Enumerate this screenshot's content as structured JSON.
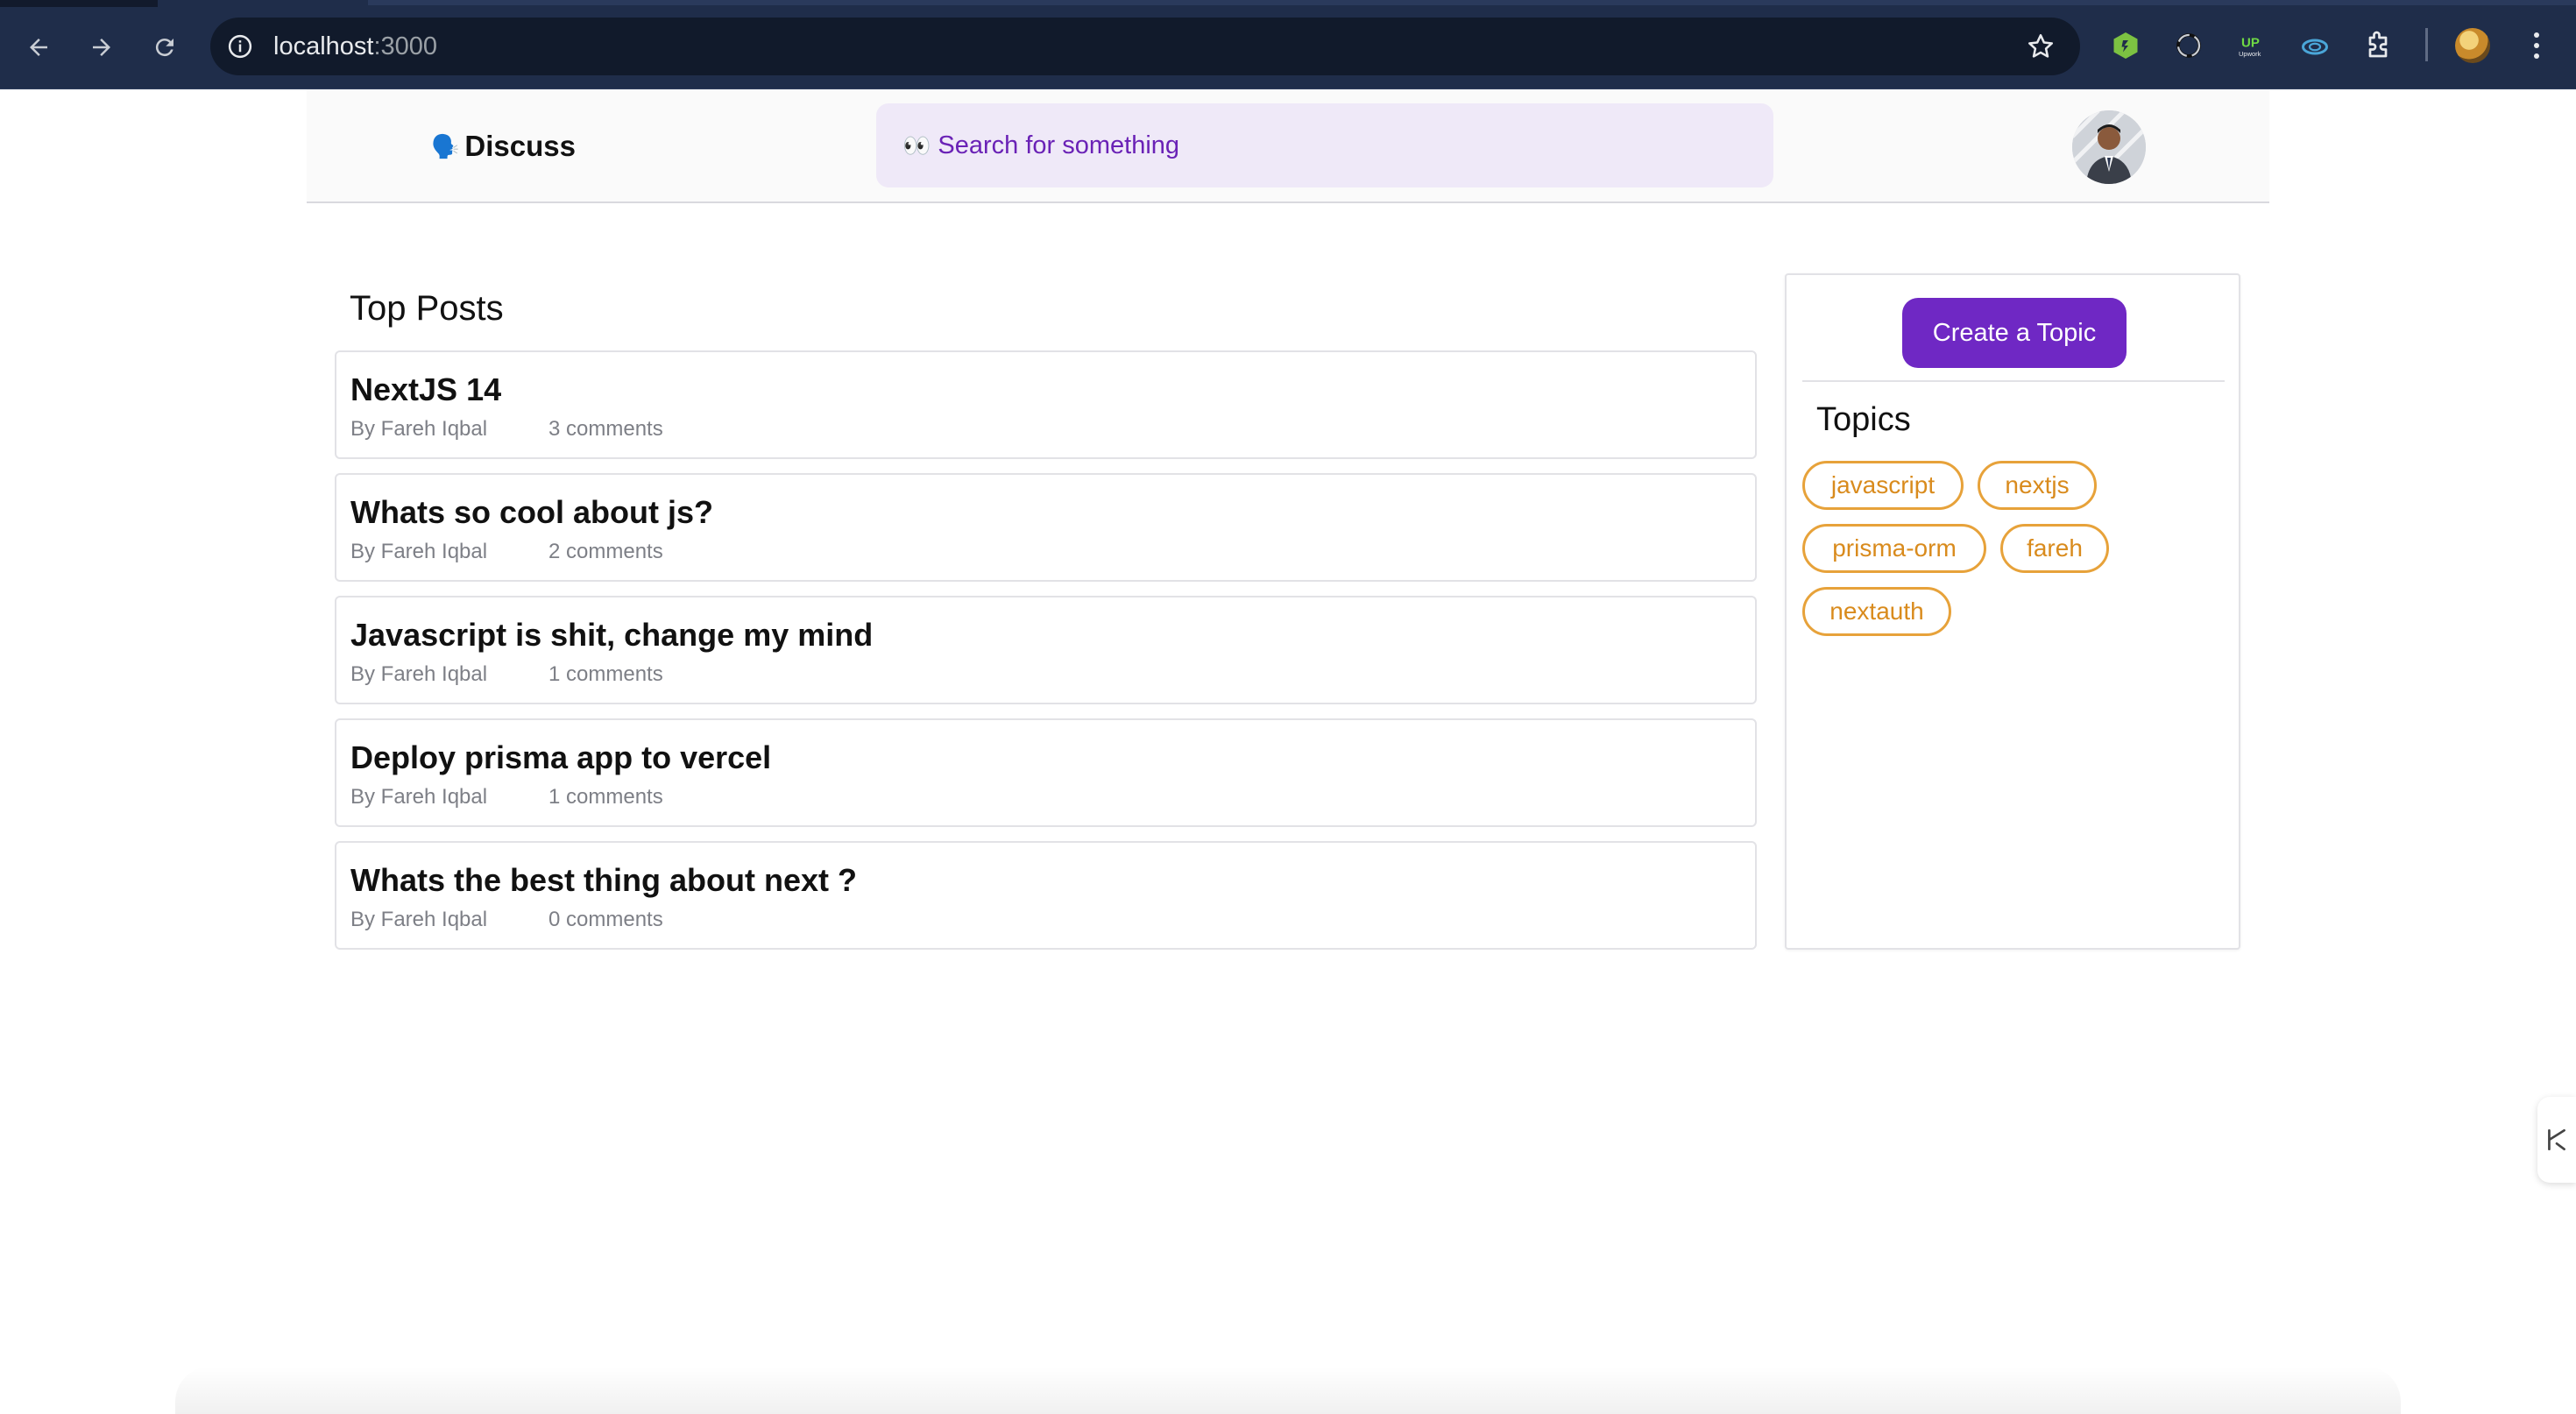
{
  "browser": {
    "url_host": "localhost",
    "url_port": ":3000"
  },
  "header": {
    "brand_emoji": "🗣️",
    "brand_label": "Discuss",
    "search_emoji": "👀",
    "search_placeholder": "Search for something"
  },
  "main": {
    "section_title": "Top Posts",
    "posts": [
      {
        "title": "NextJS 14",
        "author": "By Fareh Iqbal",
        "comments": "3 comments"
      },
      {
        "title": "Whats so cool about js?",
        "author": "By Fareh Iqbal",
        "comments": "2 comments"
      },
      {
        "title": "Javascript is shit, change my mind",
        "author": "By Fareh Iqbal",
        "comments": "1 comments"
      },
      {
        "title": "Deploy prisma app to vercel",
        "author": "By Fareh Iqbal",
        "comments": "1 comments"
      },
      {
        "title": "Whats the best thing about next ?",
        "author": "By Fareh Iqbal",
        "comments": "0 comments"
      }
    ]
  },
  "sidebar": {
    "create_label": "Create a Topic",
    "topics_title": "Topics",
    "topics": [
      "javascript",
      "nextjs",
      "prisma-orm",
      "fareh",
      "nextauth"
    ]
  },
  "colors": {
    "chrome_bg": "#1f2d4a",
    "accent_purple": "#6f28c4",
    "search_bg": "#efe9f8",
    "chip_orange": "#e7a23a"
  },
  "icons": {
    "back": "arrow-left-icon",
    "forward": "arrow-right-icon",
    "reload": "reload-icon",
    "site_info": "info-icon",
    "bookmark": "star-icon",
    "extensions": "puzzle-icon",
    "menu": "kebab-menu-icon"
  }
}
